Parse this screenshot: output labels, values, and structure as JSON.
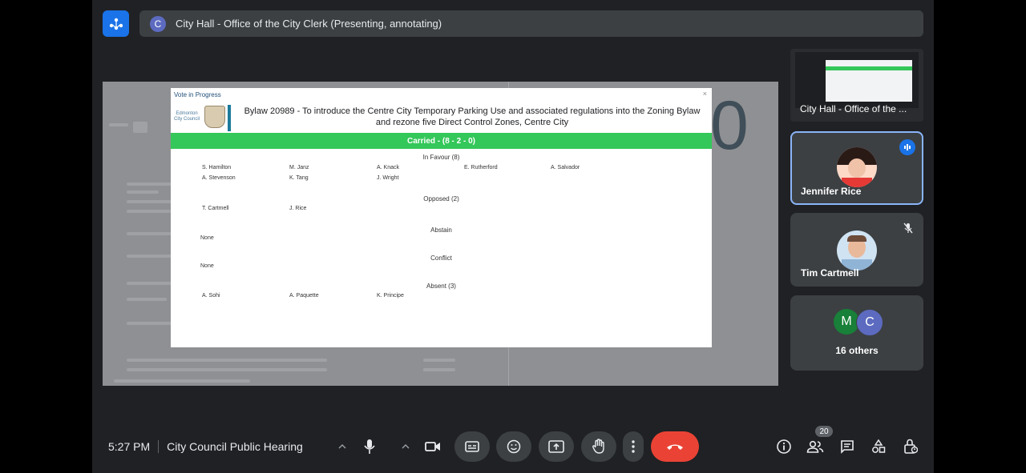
{
  "window": {
    "title": "City Hall - Office of the City Clerk (Presenting, annotating)",
    "avatar_letter": "C",
    "app_icon": "meet-app-icon"
  },
  "presentation": {
    "dialog_title": "Vote in Progress",
    "logo_text": "Edmonton City Council",
    "bylaw_line1": "Bylaw 20989 - To introduce the Centre City Temporary Parking Use and associated regulations into the Zoning Bylaw",
    "bylaw_line2": "and rezone five Direct Control Zones, Centre City",
    "result": "Carried - (8 - 2 - 0)",
    "sections": {
      "in_favour": "In Favour (8)",
      "opposed": "Opposed (2)",
      "abstain": "Abstain",
      "conflict": "Conflict",
      "absent": "Absent (3)"
    },
    "in_favour": [
      "S. Hamilton",
      "M. Janz",
      "A. Knack",
      "E. Rutherford",
      "A. Salvador",
      "A. Stevenson",
      "K. Tang",
      "J. Wright"
    ],
    "opposed": [
      "T. Cartmell",
      "J. Rice"
    ],
    "abstain": [
      "None"
    ],
    "conflict": [
      "None"
    ],
    "absent": [
      "A. Sohi",
      "A. Paquette",
      "K. Principe"
    ],
    "background_number": "0"
  },
  "sidebar": {
    "presenter_tile": "City Hall - Office of the ...",
    "participants": [
      {
        "name": "Jennifer Rice",
        "status_icon": "speaking-icon",
        "highlight_color": "#8ab4f8"
      },
      {
        "name": "Tim Cartmell",
        "status_icon": "mic-off-icon"
      }
    ],
    "others": {
      "letters": [
        "M",
        "C"
      ],
      "colors": [
        "#188038",
        "#5c6bc0"
      ],
      "label": "16 others"
    }
  },
  "toolbar": {
    "time": "5:27 PM",
    "meeting_name": "City Council Public Hearing",
    "participant_count": "20",
    "end_call_color": "#ea4335"
  }
}
